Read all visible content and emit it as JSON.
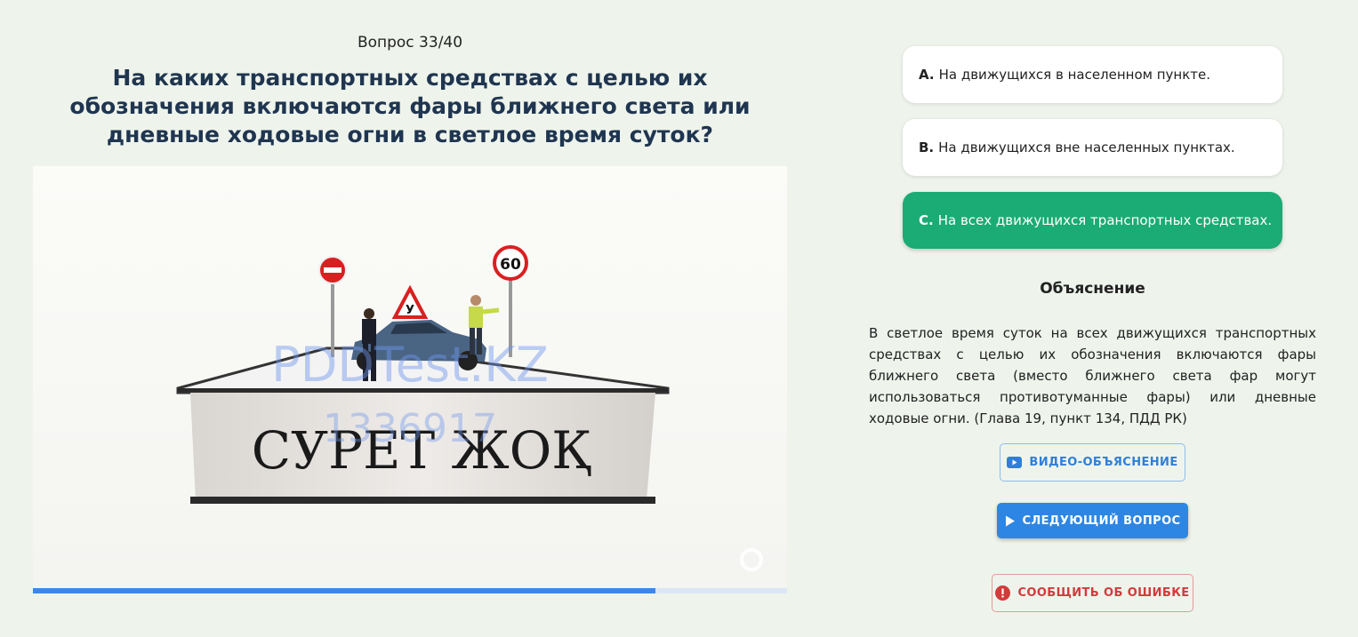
{
  "quiz": {
    "counter": "Вопрос 33/40",
    "question": "На каких транспортных средствах с целью их обозначения включаются фары ближнего света или дневные ходовые огни в светлое время суток?",
    "progress": 0.825
  },
  "image": {
    "placeholder_text": "СУРЕТ ЖОҚ",
    "watermark_site": "PDDTest.KZ",
    "watermark_id": "1336917",
    "sign_speed": "60",
    "sign_learner": "У"
  },
  "answers": [
    {
      "letter": "A.",
      "text": "На движущихся в населенном пункте.",
      "state": "default"
    },
    {
      "letter": "B.",
      "text": "На движущихся вне населенных пунктах.",
      "state": "default"
    },
    {
      "letter": "C.",
      "text": "На всех движущихся транспортных средствах.",
      "state": "correct"
    }
  ],
  "explanation": {
    "title": "Объяснение",
    "text": "В светлое время суток на всех движущихся транспортных средствах с целью их обозначения включаются фары ближнего света (вместо ближнего света фар могут использоваться противотуманные фары) или дневные ходовые огни. (Глава 19, пункт 134, ПДД РК)"
  },
  "buttons": {
    "video": {
      "label": "ВИДЕО-ОБЪЯСНЕНИЕ",
      "icon": "youtube-icon"
    },
    "next": {
      "label": "СЛЕДУЮЩИЙ ВОПРОС",
      "icon": "play-icon"
    },
    "report": {
      "label": "СООБЩИТЬ ОБ ОШИБКЕ",
      "icon": "alert-icon"
    }
  },
  "colors": {
    "background": "#eef4ec",
    "correct": "#1bab74",
    "primary": "#2d86e3",
    "danger": "#d23b3b",
    "question_text": "#1f3550"
  }
}
